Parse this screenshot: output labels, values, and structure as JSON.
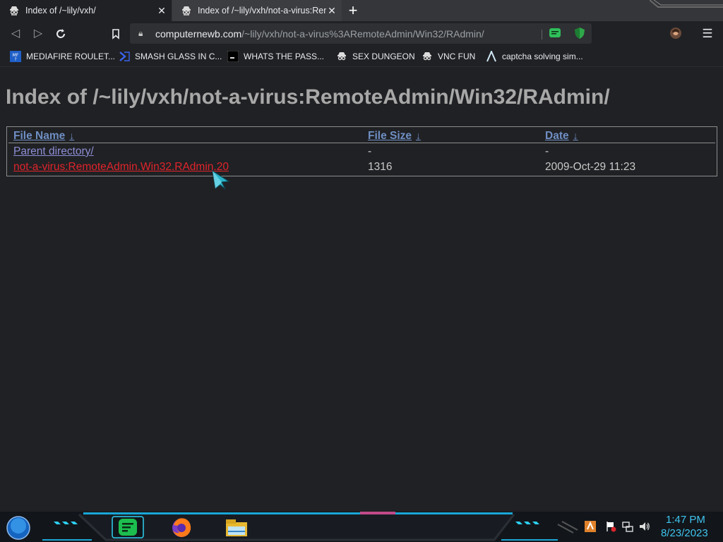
{
  "tabs": [
    {
      "title": "Index of /~lily/vxh/",
      "favicon": "spy-icon",
      "active": false
    },
    {
      "title": "Index of /~lily/vxh/not-a-virus:RemoteAdmin",
      "favicon": "spy-icon",
      "active": true
    }
  ],
  "address_bar": {
    "domain": "computernewb.com",
    "path": "/~lily/vxh/not-a-virus%3ARemoteAdmin/Win32/RAdmin/"
  },
  "bookmarks": [
    {
      "label": "MEDIAFIRE ROULET...",
      "icon": "mediafire-icon"
    },
    {
      "label": "SMASH GLASS IN C...",
      "icon": "chevron-logo-icon"
    },
    {
      "label": "WHATS THE PASS...",
      "icon": "terminal-icon"
    },
    {
      "label": "SEX DUNGEON",
      "icon": "spy-icon"
    },
    {
      "label": "VNC FUN",
      "icon": "spy-icon"
    },
    {
      "label": "captcha solving sim...",
      "icon": "a-logo-icon"
    }
  ],
  "page": {
    "title": "Index of /~lily/vxh/not-a-virus:RemoteAdmin/Win32/RAdmin/",
    "columns": [
      {
        "label": "File Name",
        "sort": "↓"
      },
      {
        "label": "File Size",
        "sort": "↓"
      },
      {
        "label": "Date",
        "sort": "↓"
      }
    ],
    "rows": [
      {
        "name": "Parent directory/",
        "size": "-",
        "date": "-"
      },
      {
        "name": "not-a-virus:RemoteAdmin.Win32.RAdmin.20",
        "size": "1316",
        "date": "2009-Oct-29 11:23"
      }
    ]
  },
  "taskbar": {
    "time": "1:47 PM",
    "date": "8/23/2023"
  },
  "colors": {
    "link_parent": "#8d8fd6",
    "link_file": "#e0242b",
    "header_link": "#6f8fc4",
    "clock": "#3fc4ee"
  }
}
